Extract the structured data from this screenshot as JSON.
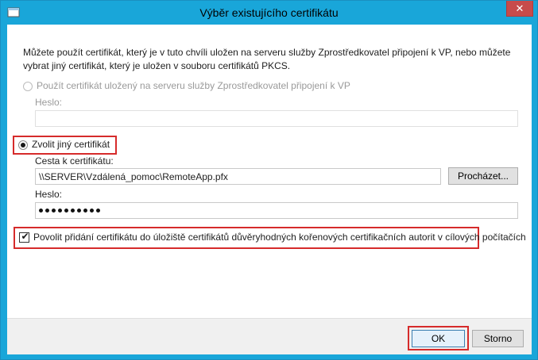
{
  "window": {
    "title": "Výběr existujícího certifikátu",
    "close_icon": "close-icon"
  },
  "dialog": {
    "description": "Můžete použít certifikát, který je v tuto chvíli uložen na serveru služby Zprostředkovatel připojení k VP, nebo můžete vybrat jiný certifikát, který je uložen v souboru certifikátů PKCS.",
    "option_server": {
      "label": "Použít certifikát uložený na serveru služby Zprostředkovatel připojení k VP",
      "selected": false,
      "enabled": false,
      "password_label": "Heslo:",
      "password_value": ""
    },
    "option_other": {
      "label": "Zvolit jiný certifikát",
      "selected": true,
      "path_label": "Cesta k certifikátu:",
      "path_value": "\\\\SERVER\\Vzdálená_pomoc\\RemoteApp.pfx",
      "browse_label": "Procházet...",
      "password_label": "Heslo:",
      "password_length": 10
    },
    "allow_checkbox": {
      "label": "Povolit přidání certifikátu do úložiště certifikátů důvěryhodných kořenových certifikačních autorit v cílových počítačích",
      "checked": true
    }
  },
  "footer": {
    "ok_label": "OK",
    "cancel_label": "Storno"
  },
  "colors": {
    "titlebar": "#19a6d9",
    "highlight": "#d62b2b",
    "close_button": "#c74b4b"
  }
}
